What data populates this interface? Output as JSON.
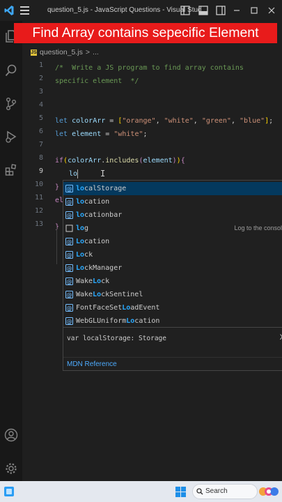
{
  "window": {
    "title": "question_5.js - JavaScript Questions - Visual Stud..."
  },
  "banner": {
    "text": "Find Array contains sepecific Element"
  },
  "breadcrumb": {
    "file_badge": "JS",
    "file": "question_5.js",
    "separator": ">",
    "more": "..."
  },
  "editor": {
    "line_numbers": [
      "1",
      "2",
      "3",
      "4",
      "5",
      "6",
      "7",
      "8",
      "9",
      "10",
      "11",
      "12",
      "13"
    ],
    "active_line": 9,
    "typed_text": "lo"
  },
  "suggest": {
    "query": "lo",
    "items": [
      {
        "pre": "",
        "match": "lo",
        "post": "calStorage",
        "kind": "variable-icon",
        "detail": ""
      },
      {
        "pre": "",
        "match": "lo",
        "post": "cation",
        "kind": "variable-icon",
        "detail": ""
      },
      {
        "pre": "",
        "match": "lo",
        "post": "cationbar",
        "kind": "variable-icon",
        "detail": ""
      },
      {
        "pre": "",
        "match": "lo",
        "post": "g",
        "kind": "snippet-icon",
        "detail": "Log to the console"
      },
      {
        "pre": "",
        "match": "Lo",
        "post": "cation",
        "kind": "variable-icon",
        "detail": ""
      },
      {
        "pre": "",
        "match": "Lo",
        "post": "ck",
        "kind": "variable-icon",
        "detail": ""
      },
      {
        "pre": "",
        "match": "Lo",
        "post": "ckManager",
        "kind": "variable-icon",
        "detail": ""
      },
      {
        "pre": "Wake",
        "match": "Lo",
        "post": "ck",
        "kind": "variable-icon",
        "detail": ""
      },
      {
        "pre": "Wake",
        "match": "Lo",
        "post": "ckSentinel",
        "kind": "variable-icon",
        "detail": ""
      },
      {
        "pre": "FontFaceSet",
        "match": "Lo",
        "post": "adEvent",
        "kind": "variable-icon",
        "detail": ""
      },
      {
        "pre": "WebGLUniform",
        "match": "Lo",
        "post": "cation",
        "kind": "variable-icon",
        "detail": ""
      }
    ],
    "signature": "var localStorage: Storage",
    "close": "X",
    "reference_link": "MDN Reference"
  },
  "taskbar": {
    "search_placeholder": "Search"
  },
  "colors": {
    "banner_bg": "#e81b1b",
    "selection": "#04395e",
    "match_highlight": "#2aaaff",
    "vscode_blue": "#3ea6f2"
  }
}
